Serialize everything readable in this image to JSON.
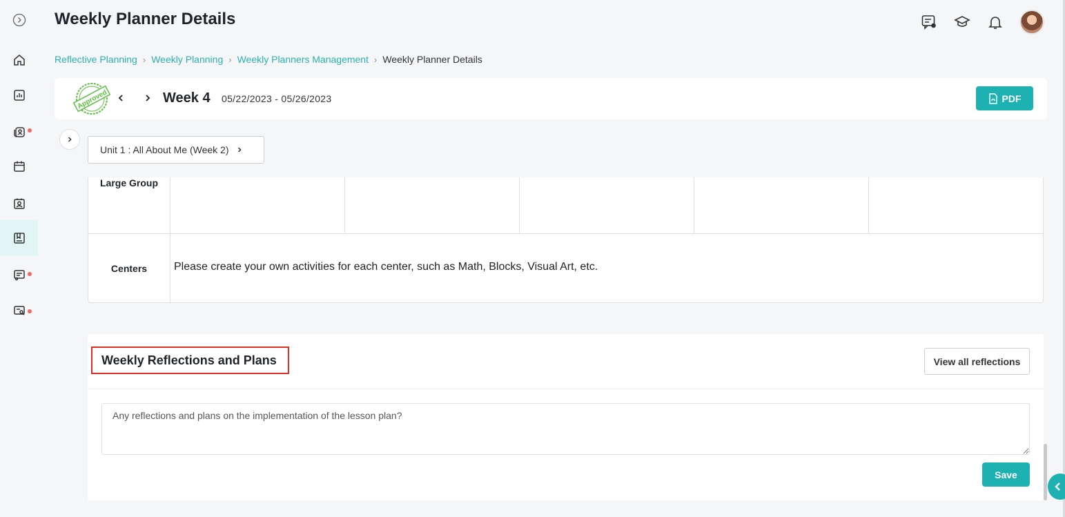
{
  "header": {
    "title": "Weekly Planner Details",
    "icons": [
      "chat-user-icon",
      "graduation-cap-icon",
      "bell-icon",
      "avatar"
    ]
  },
  "sidebar": {
    "items": [
      {
        "icon": "expand-circle-icon"
      },
      {
        "icon": "home-icon"
      },
      {
        "icon": "chart-icon"
      },
      {
        "icon": "students-icon",
        "badge": true
      },
      {
        "icon": "calendar-icon"
      },
      {
        "icon": "contact-card-icon"
      },
      {
        "icon": "planner-book-icon",
        "active": true
      },
      {
        "icon": "survey-icon",
        "badge": true
      },
      {
        "icon": "user-report-icon",
        "badge": true
      }
    ]
  },
  "breadcrumb": {
    "items": [
      "Reflective Planning",
      "Weekly Planning",
      "Weekly Planners Management"
    ],
    "current": "Weekly Planner Details"
  },
  "weekbar": {
    "stamp": "Approved",
    "week": "Week 4",
    "range": "05/22/2023 - 05/26/2023",
    "pdf_label": "PDF"
  },
  "unit": {
    "label": "Unit 1 : All About Me (Week 2)"
  },
  "table": {
    "rows": [
      {
        "label": "Large Group",
        "content": ""
      },
      {
        "label": "Centers",
        "content": "Please create your own activities for each center, such as Math, Blocks, Visual Art, etc."
      }
    ]
  },
  "reflections": {
    "title": "Weekly Reflections and Plans",
    "view_all_label": "View all reflections",
    "placeholder": "Any reflections and plans on the implementation of the lesson plan?",
    "value": "",
    "save_label": "Save"
  },
  "colors": {
    "accent": "#1eb1b2",
    "link": "#2bb0b0",
    "badge": "#f06565",
    "highlight_border": "#e02e24",
    "stamp_green": "#5cbf3f"
  }
}
